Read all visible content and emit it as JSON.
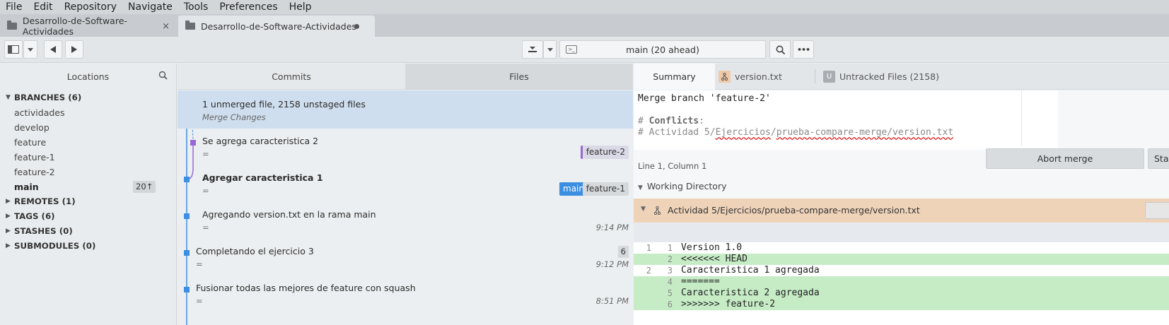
{
  "menu": [
    "File",
    "Edit",
    "Repository",
    "Navigate",
    "Tools",
    "Preferences",
    "Help"
  ],
  "tabs": [
    {
      "label": "Desarrollo-de-Software-Actividades",
      "close": "×"
    },
    {
      "label": "Desarrollo-de-Software-Actividades"
    }
  ],
  "toolbar": {
    "branch_label": "main (20 ahead)",
    "more_label": "•••"
  },
  "sidebar": {
    "title": "Locations",
    "branches_header": "BRANCHES (6)",
    "branches": [
      "actividades",
      "develop",
      "feature",
      "feature-1",
      "feature-2",
      "main"
    ],
    "main_count": "20↑",
    "sections": [
      "REMOTES (1)",
      "TAGS (6)",
      "STASHES (0)",
      "SUBMODULES (0)"
    ]
  },
  "tabs_center": {
    "commits": "Commits",
    "files": "Files"
  },
  "commits": [
    {
      "msg": "1 unmerged file, 2158 unstaged files",
      "sub": "Merge Changes"
    },
    {
      "msg": "Se agrega caracteristica 2",
      "sub": "=",
      "tags": [
        "feature-2"
      ]
    },
    {
      "msg": "Agregar caracteristica 1",
      "sub": "=",
      "tags": [
        "main",
        "feature-1"
      ]
    },
    {
      "msg": "Agregando version.txt en la rama main",
      "sub": "=",
      "time": "9:14 PM"
    },
    {
      "msg": "Completando el ejercicio 3",
      "sub": "=",
      "time": "9:12 PM",
      "badge": "6"
    },
    {
      "msg": "Fusionar todas las mejores de feature con squash",
      "sub": "=",
      "time": "8:51 PM"
    }
  ],
  "right": {
    "summary_tab": "Summary",
    "file_tab": "version.txt",
    "untracked_tab": "Untracked Files (2158)",
    "untracked_letter": "U",
    "commit_message": {
      "line1": "Merge branch 'feature-2'",
      "line2_prefix": "# ",
      "line2_bold": "Conflicts",
      "line2_suffix": ":",
      "line3_prefix": "#   Actividad 5/",
      "line3_u1": "Ejercicios",
      "line3_mid": "/",
      "line3_u2": "prueba-compare-merge/version.txt"
    },
    "line_info": "Line 1, Column 1",
    "abort_label": "Abort merge",
    "stage_label": "Sta",
    "working_dir": "Working Directory",
    "conflict_path": "Actividad 5/Ejercicios/prueba-compare-merge/version.txt",
    "diff": [
      {
        "o": "1",
        "n": "1",
        "t": "Version 1.0",
        "add": false
      },
      {
        "o": "",
        "n": "2",
        "t": "<<<<<<< HEAD",
        "add": true
      },
      {
        "o": "2",
        "n": "3",
        "t": "Caracteristica 1 agregada",
        "add": false
      },
      {
        "o": "",
        "n": "4",
        "t": "=======",
        "add": true
      },
      {
        "o": "",
        "n": "5",
        "t": "Caracteristica 2 agregada",
        "add": true
      },
      {
        "o": "",
        "n": "6",
        "t": ">>>>>>> feature-2",
        "add": true
      }
    ]
  },
  "colors": {
    "accent": "#3b8ee0",
    "merge_purple": "#9a68d6",
    "conflict_bg": "#efd3b9",
    "diff_add": "#c6ecc6"
  }
}
